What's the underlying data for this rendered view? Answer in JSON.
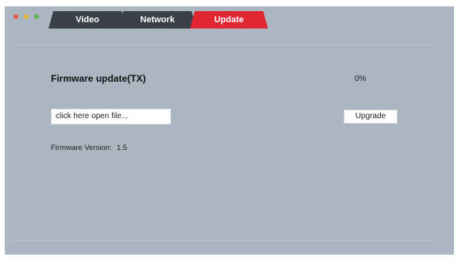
{
  "window": {
    "traffic_lights": [
      {
        "name": "close",
        "color": "#e55b4d"
      },
      {
        "name": "minimize",
        "color": "#e6b339"
      },
      {
        "name": "maximize",
        "color": "#5cb54f"
      }
    ]
  },
  "tabs": [
    {
      "label": "Video",
      "active": false
    },
    {
      "label": "Network",
      "active": false
    },
    {
      "label": "Update",
      "active": true
    }
  ],
  "colors": {
    "active_tab": "#e02630",
    "inactive_tab": "#3b3f47",
    "background": "#abb6c0"
  },
  "update": {
    "title": "Firmware update(TX)",
    "progress_text": "0%",
    "file_placeholder": "click here open file...",
    "upgrade_label": "Upgrade",
    "version_label": "Firmware Version:",
    "version_value": "1.5"
  }
}
